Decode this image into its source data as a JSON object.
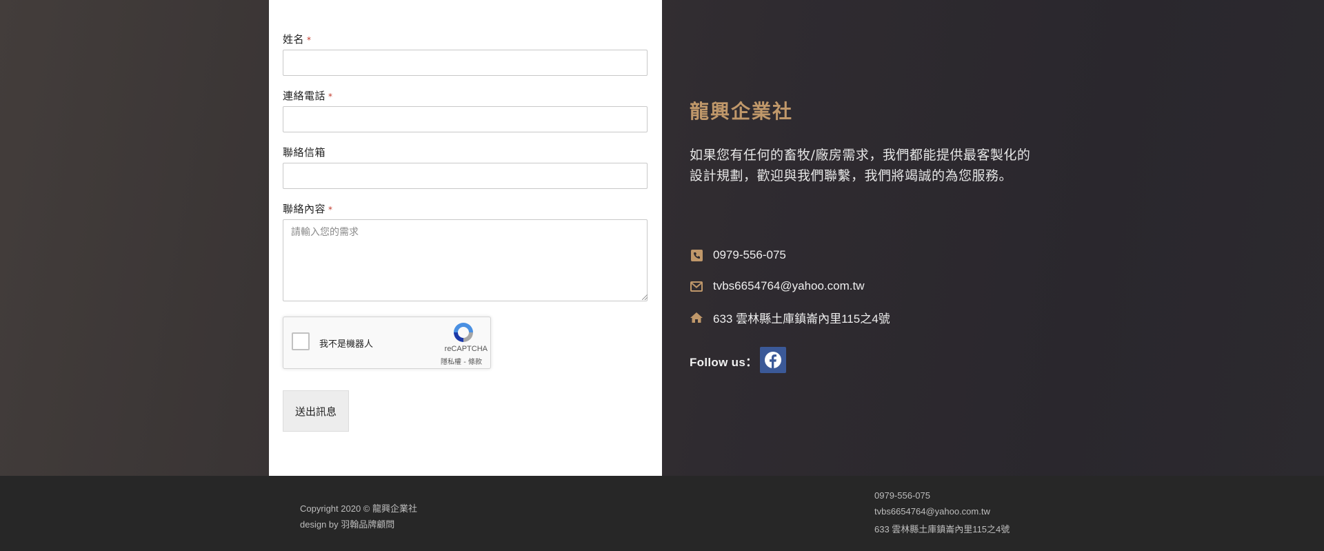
{
  "form": {
    "name_label": "姓名",
    "phone_label": "連絡電話",
    "email_label": "聯絡信箱",
    "message_label": "聯絡內容",
    "required_mark": "*",
    "message_placeholder": "請輸入您的需求",
    "recaptcha": {
      "label": "我不是機器人",
      "brand": "reCAPTCHA",
      "terms": "隱私權 - 條款"
    },
    "submit_label": "送出訊息"
  },
  "info": {
    "title": "龍興企業社",
    "description": "如果您有任何的畜牧/廠房需求，我們都能提供最客製化的設計規劃，歡迎與我們聯繫，我們將竭誠的為您服務。",
    "phone": "0979-556-075",
    "email": "tvbs6654764@yahoo.com.tw",
    "address": "633 雲林縣土庫鎮崙內里115之4號",
    "follow_label": "Follow us：",
    "accent_color": "#c0986a",
    "facebook_color": "#3b5998"
  },
  "footer": {
    "copyright": "Copyright 2020 © 龍興企業社",
    "design": "design by 羽翰品牌顧問",
    "phone": "0979-556-075",
    "email": "tvbs6654764@yahoo.com.tw",
    "address": "633 雲林縣土庫鎮崙內里115之4號"
  }
}
